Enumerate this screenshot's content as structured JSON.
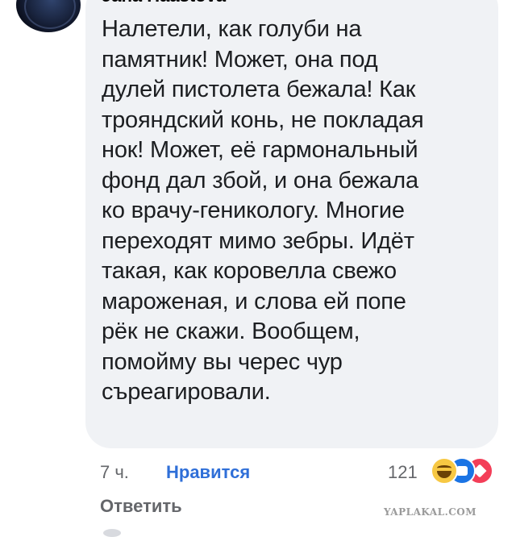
{
  "comment": {
    "author": "Jana Haastova",
    "lines": [
      "Налетели, как голуби на",
      "памятник! Может, она под",
      "дулей пистолета бежала! Как",
      "трояндский конь, не покладая",
      "нок! Может, её гармональный",
      "фонд дал збой, и она бежала",
      "ко врачу-геникологу. Многие",
      "переходят мимо зебры. Идёт",
      "такая, как коровелла свежо",
      "мароженая, и слова ей попе",
      "рёк не скажи. Вообщем,",
      "помойму вы черес чур",
      "съреагировали."
    ]
  },
  "actions": {
    "time": "7 ч.",
    "like_label": "Нравится",
    "reply_label": "Ответить",
    "reaction_count": "121"
  },
  "reactions": {
    "icons": [
      "haha-icon",
      "like-icon",
      "love-icon"
    ],
    "colors": {
      "haha": "#f7c843",
      "like": "#1b74e4",
      "love": "#f33e58"
    }
  },
  "watermark": "YAPLAKAL.COM",
  "colors": {
    "bubble": "#f0f2f5",
    "text": "#1c1e21",
    "meta": "#65676b",
    "link": "#2f6fd8"
  }
}
